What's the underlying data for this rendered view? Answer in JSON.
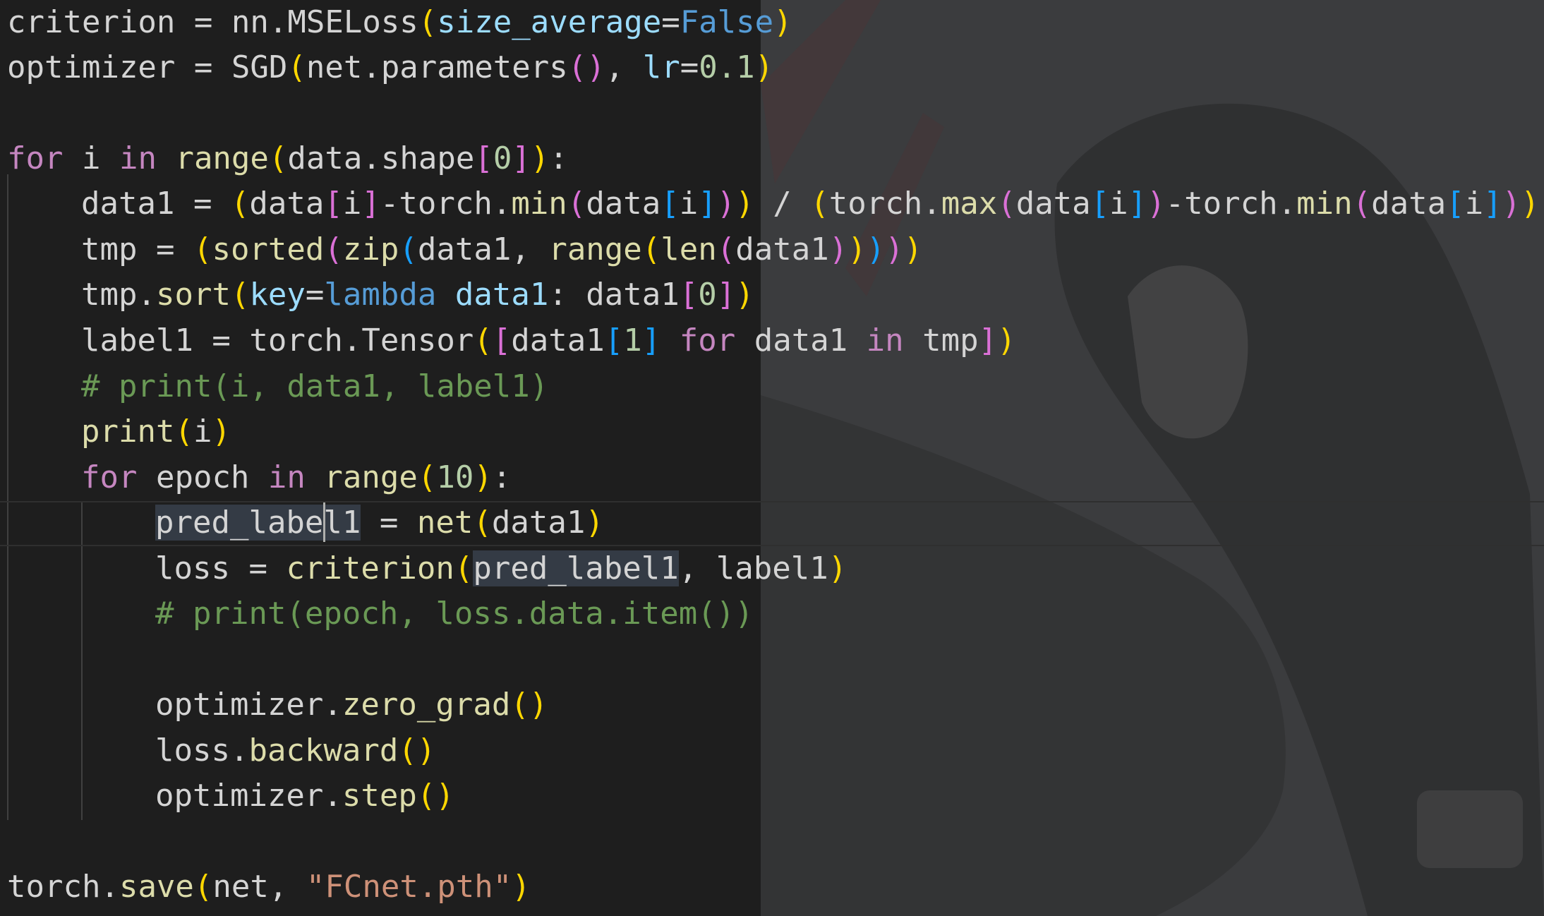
{
  "colors": {
    "keyword": "#c586c0",
    "function": "#dcdcaa",
    "parameter": "#9cdcfe",
    "constant": "#569cd6",
    "number": "#b5cea8",
    "string": "#ce9178",
    "comment": "#6a9955",
    "bracket_level1": "#ffd700",
    "bracket_level2": "#da70d6",
    "bracket_level3": "#179fff"
  },
  "code": {
    "line1": {
      "a": "criterion = nn.MSELoss",
      "b": "(",
      "c": "size_average",
      "d": "=",
      "e": "False",
      "f": ")"
    },
    "line2": {
      "a": "optimizer = SGD",
      "b": "(",
      "c": "net.parameters",
      "d": "()",
      "e": ", ",
      "f": "lr",
      "g": "=",
      "h": "0.1",
      "i": ")"
    },
    "line3": {
      "a": "for",
      "b": " i ",
      "c": "in",
      "d": " ",
      "e": "range",
      "f": "(",
      "g": "data.shape",
      "h": "[",
      "i": "0",
      "j": "]",
      "k": ")",
      "l": ":"
    },
    "line4": {
      "a": "data1 = ",
      "b": "(",
      "c": "data",
      "d": "[",
      "e": "i",
      "f": "]",
      "g": "-torch.",
      "h": "min",
      "i": "(",
      "j": "data",
      "k": "[",
      "l": "i",
      "m": "]",
      "n": ")",
      "o": ")",
      "p": " / ",
      "q": "(",
      "r": "torch.",
      "s": "max",
      "t": "(",
      "u": "data",
      "v": "[",
      "w": "i",
      "x": "]",
      "y": ")",
      "z": "-torch.",
      "aa": "min",
      "ab": "(",
      "ac": "data",
      "ad": "[",
      "ae": "i",
      "af": "]",
      "ag": ")",
      "ah": ")"
    },
    "line5": {
      "a": "tmp = ",
      "b": "(",
      "c": "sorted",
      "d": "(",
      "e": "zip",
      "f": "(",
      "g": "data1, ",
      "h": "range",
      "i": "(",
      "j": "len",
      "k": "(",
      "l": "data1",
      "m": ")",
      "n": ")",
      "o": ")",
      "p": ")",
      "q": ")"
    },
    "line6": {
      "a": "tmp.",
      "b": "sort",
      "c": "(",
      "d": "key",
      "e": "=",
      "f": "lambda",
      "g": " ",
      "h": "data1",
      "i": ": data1",
      "j": "[",
      "k": "0",
      "l": "]",
      "m": ")"
    },
    "line7": {
      "a": "label1 = torch.Tensor",
      "b": "(",
      "c": "[",
      "d": "data1",
      "e": "[",
      "f": "1",
      "g": "]",
      "h": " ",
      "i": "for",
      "j": " data1 ",
      "k": "in",
      "l": " tmp",
      "m": "]",
      "n": ")"
    },
    "line8": {
      "a": "# print(i, data1, label1)"
    },
    "line9": {
      "a": "print",
      "b": "(",
      "c": "i",
      "d": ")"
    },
    "line10": {
      "a": "for",
      "b": " epoch ",
      "c": "in",
      "d": " ",
      "e": "range",
      "f": "(",
      "g": "10",
      "h": ")",
      "i": ":"
    },
    "line11": {
      "a": "pred_label1",
      "b": " = ",
      "c": "net",
      "d": "(",
      "e": "data1",
      "f": ")"
    },
    "line12": {
      "a": "loss = ",
      "b": "criterion",
      "c": "(",
      "d": "pred_label1",
      "e": ", label1",
      "f": ")"
    },
    "line13": {
      "a": "# print(epoch, loss.data.item())"
    },
    "line14": {
      "a": "optimizer.",
      "b": "zero_grad",
      "c": "()"
    },
    "line15": {
      "a": "loss.",
      "b": "backward",
      "c": "()"
    },
    "line16": {
      "a": "optimizer.",
      "b": "step",
      "c": "()"
    },
    "line17": {
      "a": "torch.",
      "b": "save",
      "c": "(",
      "d": "net, ",
      "e": "\"FCnet.pth\"",
      "f": ")"
    }
  }
}
